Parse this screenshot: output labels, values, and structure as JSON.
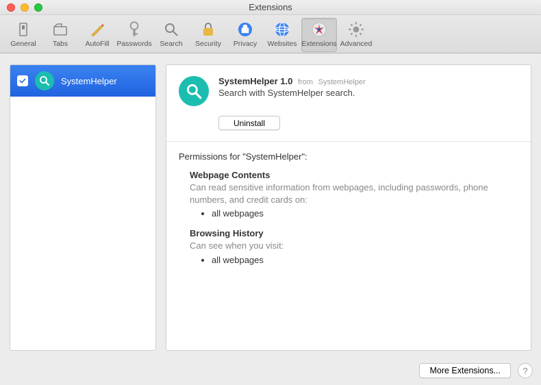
{
  "window": {
    "title": "Extensions"
  },
  "toolbar": {
    "items": [
      {
        "label": "General"
      },
      {
        "label": "Tabs"
      },
      {
        "label": "AutoFill"
      },
      {
        "label": "Passwords"
      },
      {
        "label": "Search"
      },
      {
        "label": "Security"
      },
      {
        "label": "Privacy"
      },
      {
        "label": "Websites"
      },
      {
        "label": "Extensions"
      },
      {
        "label": "Advanced"
      }
    ]
  },
  "sidebar": {
    "items": [
      {
        "name": "SystemHelper",
        "enabled": true
      }
    ]
  },
  "detail": {
    "name": "SystemHelper 1.0",
    "from_prefix": "from",
    "from": "SystemHelper",
    "description": "Search with SystemHelper search.",
    "uninstall_label": "Uninstall",
    "permissions_title": "Permissions for \"SystemHelper\":",
    "permissions": [
      {
        "heading": "Webpage Contents",
        "body": "Can read sensitive information from webpages, including passwords, phone numbers, and credit cards on:",
        "bullets": [
          "all webpages"
        ]
      },
      {
        "heading": "Browsing History",
        "body": "Can see when you visit:",
        "bullets": [
          "all webpages"
        ]
      }
    ]
  },
  "footer": {
    "more_label": "More Extensions...",
    "help_label": "?"
  }
}
